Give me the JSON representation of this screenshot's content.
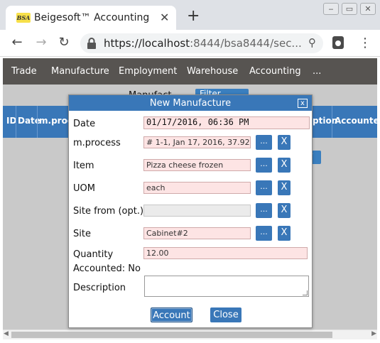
{
  "browser": {
    "tab_title": "Beigesoft™ Accounting",
    "favicon_text": "BSA",
    "tab_close": "✕",
    "new_tab": "+",
    "url_host": "https://localhost",
    "url_rest": ":8444/bsa8444/sec..."
  },
  "app_nav": {
    "items": [
      "Trade",
      "Manufacture",
      "Employment",
      "Warehouse",
      "Accounting",
      "..."
    ]
  },
  "page": {
    "label": "Manufact...",
    "filter_button": "Filter ...",
    "table_headers": [
      "ID",
      "Date",
      "m.proc",
      "ption",
      "Accounted"
    ],
    "row_button": "w"
  },
  "dialog": {
    "title": "New Manufacture",
    "close": "x",
    "fields": {
      "date": {
        "label": "Date",
        "value": "01/17/2016, 06:36 PM"
      },
      "mprocess": {
        "label": "m.process",
        "value": "# 1-1, Jan 17, 2016, 37.92"
      },
      "item": {
        "label": "Item",
        "value": "Pizza cheese frozen"
      },
      "uom": {
        "label": "UOM",
        "value": "each"
      },
      "site_from": {
        "label": "Site from (opt.)",
        "value": ""
      },
      "site": {
        "label": "Site",
        "value": "Cabinet#2"
      },
      "quantity": {
        "label": "Quantity",
        "value": "12.00"
      },
      "accounted": {
        "label": "Accounted: No"
      },
      "description": {
        "label": "Description",
        "value": ""
      }
    },
    "select_label": "...",
    "clear_label": "X",
    "account_button": "Account",
    "close_button": "Close"
  },
  "colors": {
    "accent": "#3977b8",
    "nav_bg": "#575451",
    "required_bg": "#fde4e4"
  }
}
